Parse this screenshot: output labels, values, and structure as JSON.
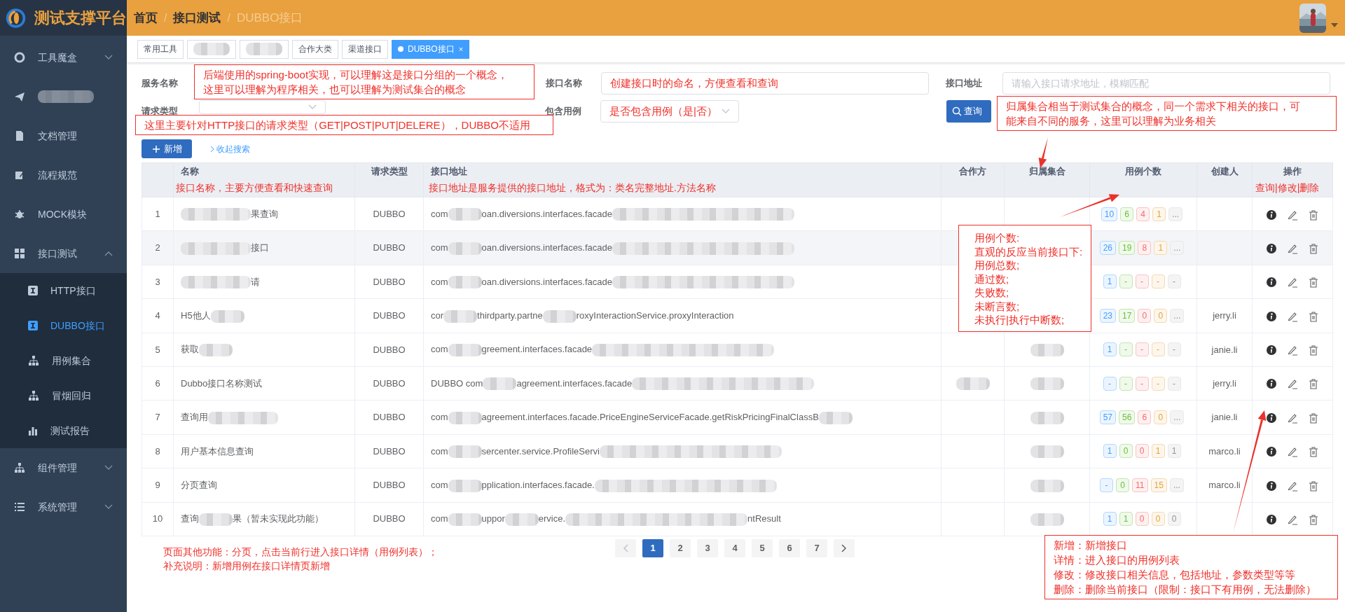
{
  "brand": {
    "title": "测试支撑平台"
  },
  "breadcrumb": [
    {
      "label": "首页",
      "current": false
    },
    {
      "separator": "/",
      "label": "接口测试",
      "current": false
    },
    {
      "separator": "/",
      "label": "DUBBO接口",
      "current": true
    }
  ],
  "sidebar": {
    "items": [
      {
        "kind": "text",
        "label": "工具魔盒",
        "expanded": false
      },
      {
        "kind": "blur"
      },
      {
        "kind": "text",
        "label": "文档管理"
      },
      {
        "kind": "text",
        "label": "流程规范"
      },
      {
        "kind": "text",
        "label": "MOCK模块"
      },
      {
        "kind": "text",
        "label": "接口测试",
        "expanded": true,
        "children": [
          {
            "label": "HTTP接口",
            "selected": false
          },
          {
            "label": "DUBBO接口",
            "selected": true
          },
          {
            "label": "用例集合",
            "selected": false
          },
          {
            "label": "冒烟回归",
            "selected": false
          },
          {
            "label": "测试报告",
            "selected": false
          }
        ]
      },
      {
        "kind": "text",
        "label": "组件管理",
        "expanded": false
      },
      {
        "kind": "text",
        "label": "系统管理",
        "expanded": false
      }
    ]
  },
  "tabs": [
    {
      "kind": "text",
      "label": "常用工具",
      "selected": false
    },
    {
      "kind": "blur",
      "selected": false
    },
    {
      "kind": "blur",
      "selected": false
    },
    {
      "kind": "text",
      "label": "合作大类",
      "selected": false
    },
    {
      "kind": "text",
      "label": "渠道接口",
      "selected": false
    },
    {
      "kind": "text",
      "label": "DUBBO接口",
      "selected": true,
      "close": "×"
    }
  ],
  "search": {
    "fields": [
      {
        "label": "服务名称"
      },
      {
        "kind": "input",
        "label": "接口名称",
        "value": "创建接口时的命名，方便查看和查询"
      },
      {
        "kind": "input",
        "label": "接口地址",
        "placeholder": "请输入接口请求地址，模糊匹配"
      },
      {
        "kind": "select",
        "label": "请求类型"
      },
      {
        "kind": "select",
        "label": "包含用例",
        "value": "是否包含用例（是|否）"
      }
    ],
    "query_button": "查询",
    "add_button": "新增",
    "collapse_link": "收起搜索"
  },
  "table": {
    "columns": [
      "名称",
      "请求类型",
      "接口地址",
      "合作方",
      "归属集合",
      "用例个数",
      "创建人",
      "操作"
    ],
    "rows": [
      {
        "index": "1",
        "selected": false,
        "name": [
          {
            "kind": "blur_long"
          },
          {
            "kind": "text",
            "text": "果查询"
          }
        ],
        "type": "DUBBO",
        "address": [
          {
            "kind": "text",
            "text": "com"
          },
          {
            "kind": "blur"
          },
          {
            "kind": "text",
            "text": "oan.diversions.interfaces.facade"
          },
          {
            "kind": "blur_long"
          }
        ],
        "counts": [
          "10",
          "6",
          "4",
          "1",
          "..."
        ]
      },
      {
        "index": "2",
        "selected": true,
        "name": [
          {
            "kind": "blur_long"
          },
          {
            "kind": "text",
            "text": "接口"
          }
        ],
        "type": "DUBBO",
        "address": [
          {
            "kind": "text",
            "text": "com"
          },
          {
            "kind": "blur"
          },
          {
            "kind": "text",
            "text": "oan.diversions.interfaces.facade"
          },
          {
            "kind": "blur_long"
          }
        ],
        "counts": [
          "26",
          "19",
          "8",
          "1",
          "..."
        ]
      },
      {
        "index": "3",
        "selected": false,
        "name": [
          {
            "kind": "blur_long"
          },
          {
            "kind": "text",
            "text": "请"
          }
        ],
        "type": "DUBBO",
        "address": [
          {
            "kind": "text",
            "text": "com"
          },
          {
            "kind": "blur"
          },
          {
            "kind": "text",
            "text": "oan.diversions.interfaces.facade"
          },
          {
            "kind": "blur_long"
          }
        ],
        "counts": [
          "1",
          "-",
          "-",
          "-",
          "-"
        ]
      },
      {
        "index": "4",
        "selected": false,
        "name": [
          {
            "kind": "text",
            "text": "H5他人"
          },
          {
            "kind": "blur"
          }
        ],
        "type": "DUBBO",
        "address": [
          {
            "kind": "text",
            "text": "cor"
          },
          {
            "kind": "blur"
          },
          {
            "kind": "text",
            "text": "thirdparty.partne"
          },
          {
            "kind": "blur"
          },
          {
            "kind": "text",
            "text": "roxyInteractionService.proxyInteraction"
          }
        ],
        "counts": [
          "23",
          "17",
          "0",
          "0",
          "..."
        ],
        "creator": "jerry.li"
      },
      {
        "index": "5",
        "selected": false,
        "name": [
          {
            "kind": "text",
            "text": "获取"
          },
          {
            "kind": "blur"
          }
        ],
        "type": "DUBBO",
        "address": [
          {
            "kind": "text",
            "text": "com"
          },
          {
            "kind": "blur"
          },
          {
            "kind": "text",
            "text": "greement.interfaces.facade"
          },
          {
            "kind": "blur_long"
          }
        ],
        "collection": [
          {
            "kind": "blur"
          }
        ],
        "counts": [
          "1",
          "-",
          "-",
          "-",
          "-"
        ],
        "creator": "janie.li"
      },
      {
        "index": "6",
        "selected": false,
        "name": [
          {
            "kind": "text",
            "text": "Dubbo接口名称测试"
          }
        ],
        "type": "DUBBO",
        "address": [
          {
            "kind": "text",
            "text": "DUBBO com"
          },
          {
            "kind": "blur"
          },
          {
            "kind": "text",
            "text": "agreement.interfaces.facade"
          },
          {
            "kind": "blur_long"
          }
        ],
        "partner": [
          {
            "kind": "blur"
          }
        ],
        "collection": [
          {
            "kind": "blur"
          }
        ],
        "counts": [
          "-",
          "-",
          "-",
          "-",
          "-"
        ],
        "creator": "jerry.li"
      },
      {
        "index": "7",
        "selected": false,
        "name": [
          {
            "kind": "text",
            "text": "查询用"
          },
          {
            "kind": "blur_long"
          }
        ],
        "type": "DUBBO",
        "address": [
          {
            "kind": "text",
            "text": "com"
          },
          {
            "kind": "blur"
          },
          {
            "kind": "text",
            "text": "agreement.interfaces.facade.PriceEngineServiceFacade.getRiskPricingFinalClassB"
          },
          {
            "kind": "blur"
          }
        ],
        "collection": [
          {
            "kind": "blur"
          }
        ],
        "counts": [
          "57",
          "56",
          "6",
          "0",
          "..."
        ],
        "creator": "janie.li"
      },
      {
        "index": "8",
        "selected": false,
        "name": [
          {
            "kind": "text",
            "text": "用户基本信息查询"
          }
        ],
        "type": "DUBBO",
        "address": [
          {
            "kind": "text",
            "text": "com"
          },
          {
            "kind": "blur"
          },
          {
            "kind": "text",
            "text": "sercenter.service.ProfileServi"
          },
          {
            "kind": "blur_long"
          }
        ],
        "collection": [
          {
            "kind": "blur"
          }
        ],
        "counts": [
          "1",
          "0",
          "0",
          "1",
          "1"
        ],
        "creator": "marco.li"
      },
      {
        "index": "9",
        "selected": false,
        "name": [
          {
            "kind": "text",
            "text": "分页查询"
          }
        ],
        "type": "DUBBO",
        "address": [
          {
            "kind": "text",
            "text": "com"
          },
          {
            "kind": "blur"
          },
          {
            "kind": "text",
            "text": "pplication.interfaces.facade."
          },
          {
            "kind": "blur_long"
          }
        ],
        "collection": [
          {
            "kind": "blur"
          }
        ],
        "counts": [
          "-",
          "0",
          "11",
          "15",
          "..."
        ],
        "creator": "marco.li"
      },
      {
        "index": "10",
        "selected": false,
        "name": [
          {
            "kind": "text",
            "text": "查询"
          },
          {
            "kind": "blur"
          },
          {
            "kind": "text",
            "text": "果（暂未实现此功能）"
          }
        ],
        "type": "DUBBO",
        "address": [
          {
            "kind": "text",
            "text": "com"
          },
          {
            "kind": "blur"
          },
          {
            "kind": "text",
            "text": "uppor"
          },
          {
            "kind": "blur"
          },
          {
            "kind": "text",
            "text": "ervice."
          },
          {
            "kind": "blur_long"
          },
          {
            "kind": "text",
            "text": "ntResult"
          }
        ],
        "collection": [
          {
            "kind": "blur"
          }
        ],
        "counts": [
          "1",
          "1",
          "0",
          "0",
          "0"
        ]
      }
    ]
  },
  "pagination": {
    "pages": [
      {
        "label": "1",
        "selected": true
      },
      {
        "label": "2",
        "selected": false
      },
      {
        "label": "3",
        "selected": false
      },
      {
        "label": "4",
        "selected": false
      },
      {
        "label": "5",
        "selected": false
      },
      {
        "label": "6",
        "selected": false
      },
      {
        "label": "7",
        "selected": false
      }
    ]
  },
  "annotations": [
    {
      "kind": "boxed",
      "lines": [
        "后端使用的spring-boot实现，可以理解这是接口分组的一个概念，",
        "这里可以理解为程序相关，也可以理解为测试集合的概念"
      ]
    },
    {
      "kind": "boxed",
      "lines": [
        "这里主要针对HTTP接口的请求类型（GET|POST|PUT|DELERE），DUBBO不适用"
      ]
    },
    {
      "kind": "boxed",
      "lines": [
        "归属集合相当于测试集合的概念，同一个需求下相关的接口，可",
        "能来自不同的服务，这里可以理解为业务相关"
      ]
    },
    {
      "kind": "boxed",
      "lines": [
        "用例个数:",
        "直观的反应当前接口下:",
        "用例总数;",
        "通过数;",
        "失败数;",
        "未断言数;",
        "未执行|执行中断数;"
      ]
    },
    {
      "kind": "boxed",
      "lines": [
        "新增：新增接口",
        "详情：进入接口的用例列表",
        "修改：修改接口相关信息，包括地址，参数类型等等",
        "删除：删除当前接口（限制：接口下有用例，无法删除）"
      ]
    },
    {
      "kind": "plain",
      "lines": [
        "接口名称，主要方便查看和快速查询"
      ]
    },
    {
      "kind": "plain",
      "lines": [
        "接口地址是服务提供的接口地址，格式为：类名完整地址.方法名称"
      ]
    },
    {
      "kind": "plain",
      "lines": [
        "查询|修改|删除"
      ]
    },
    {
      "kind": "plain",
      "lines": [
        "页面其他功能：分页，点击当前行进入接口详情（用例列表）；",
        "补充说明：新增用例在接口详情页新增"
      ]
    }
  ]
}
